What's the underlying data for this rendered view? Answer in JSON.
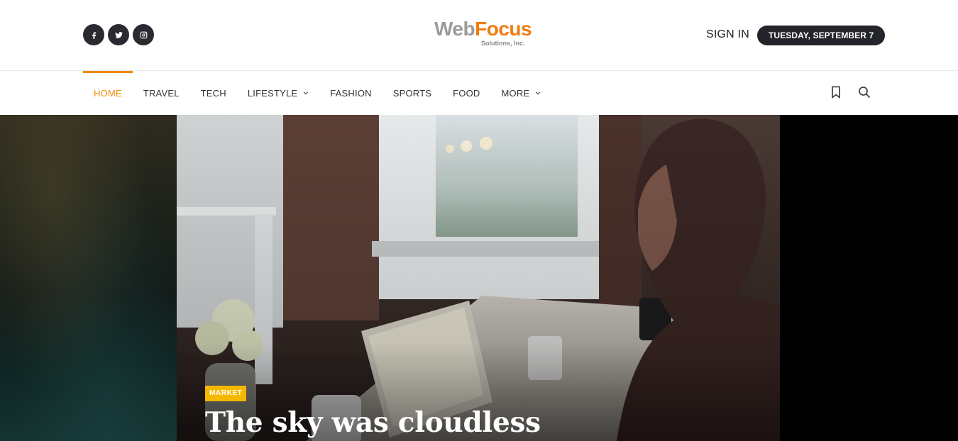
{
  "header": {
    "social_icons": [
      "facebook-icon",
      "twitter-icon",
      "instagram-icon"
    ],
    "logo": {
      "word_1": "Web",
      "word_2": "Focus",
      "tagline": "Solutions, Inc."
    },
    "sign_in_label": "SIGN IN",
    "date_label": "TUESDAY, SEPTEMBER 7"
  },
  "nav": {
    "items": [
      {
        "label": "HOME"
      },
      {
        "label": "TRAVEL"
      },
      {
        "label": "TECH"
      },
      {
        "label": "LIFESTYLE"
      },
      {
        "label": "FASHION"
      },
      {
        "label": "SPORTS"
      },
      {
        "label": "FOOD"
      },
      {
        "label": "MORE"
      }
    ],
    "active_item": "HOME",
    "right_icons": [
      "bookmark-icon",
      "search-icon"
    ]
  },
  "hero": {
    "category_tag": "MARKET",
    "headline": "The sky was cloudless"
  },
  "colors": {
    "accent": "#f0880a",
    "logo_grey": "#9b9b9b",
    "logo_orange": "#f07c0f",
    "tag_yellow": "#f5b800",
    "dark_pill": "#23252b"
  }
}
